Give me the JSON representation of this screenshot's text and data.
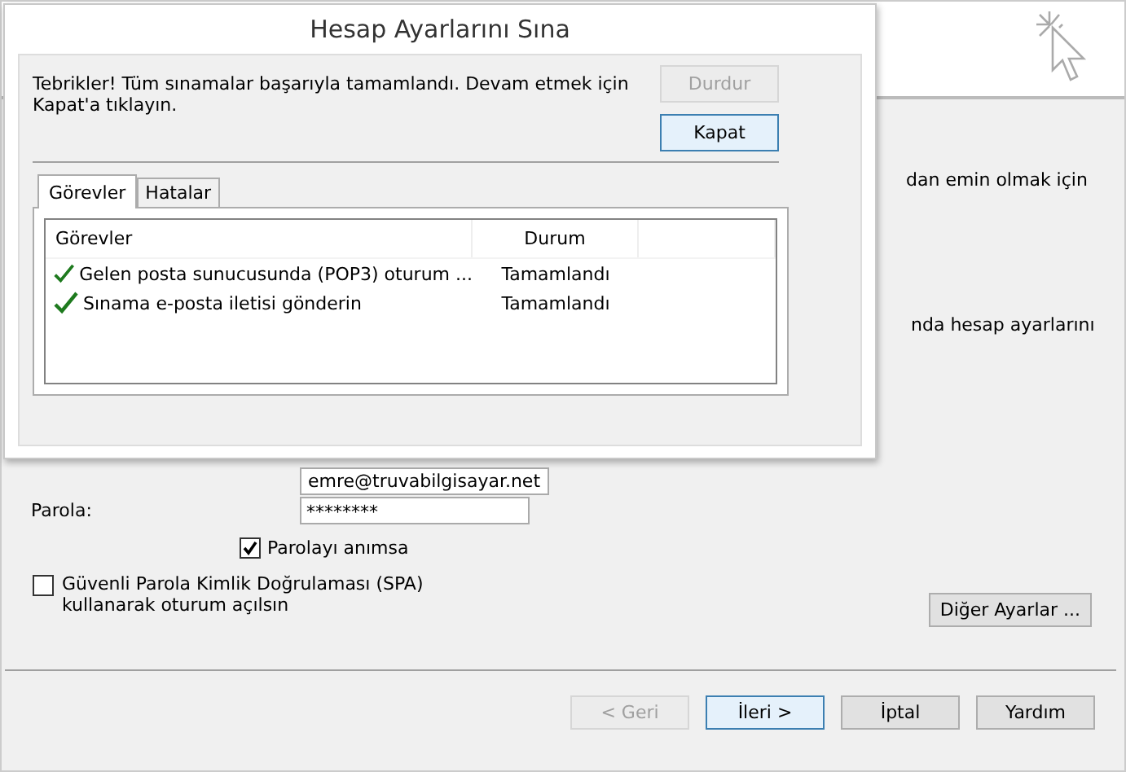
{
  "background_window": {
    "text_lines": [
      "dan emin olmak için",
      "nda hesap ayarlarını"
    ],
    "password_field": {
      "label": "Parola:",
      "value": "********"
    },
    "email_field": {
      "value": "emre@truvabilgisayar.net"
    },
    "remember_password": {
      "label": "Parolayı anımsa",
      "checked": true
    },
    "spa": {
      "label": "Güvenli Parola Kimlik Doğrulaması (SPA) kullanarak oturum açılsın",
      "checked": false
    },
    "more_settings_button": "Diğer Ayarlar ...",
    "buttons": [
      {
        "label": "< Geri",
        "disabled": true,
        "focused": false
      },
      {
        "label": "İleri >",
        "disabled": false,
        "focused": true
      },
      {
        "label": "İptal",
        "disabled": false,
        "focused": false
      },
      {
        "label": "Yardım",
        "disabled": false,
        "focused": false
      }
    ]
  },
  "dialog": {
    "title": "Hesap Ayarlarını Sına",
    "message": "Tebrikler! Tüm sınamalar başarıyla tamamlandı. Devam etmek için Kapat'a tıklayın.",
    "buttons": [
      {
        "label": "Durdur",
        "disabled": true,
        "focused": false
      },
      {
        "label": "Kapat",
        "disabled": false,
        "focused": true
      }
    ],
    "tabs": [
      {
        "label": "Görevler",
        "selected": true
      },
      {
        "label": "Hatalar",
        "selected": false
      }
    ],
    "table": {
      "columns": [
        "Görevler",
        "Durum"
      ],
      "rows": [
        {
          "task": "Gelen posta sunucusunda (POP3) oturum ...",
          "status": "Tamamlandı",
          "done": true
        },
        {
          "task": "Sınama e-posta iletisi gönderin",
          "status": "Tamamlandı",
          "done": true
        }
      ]
    }
  }
}
